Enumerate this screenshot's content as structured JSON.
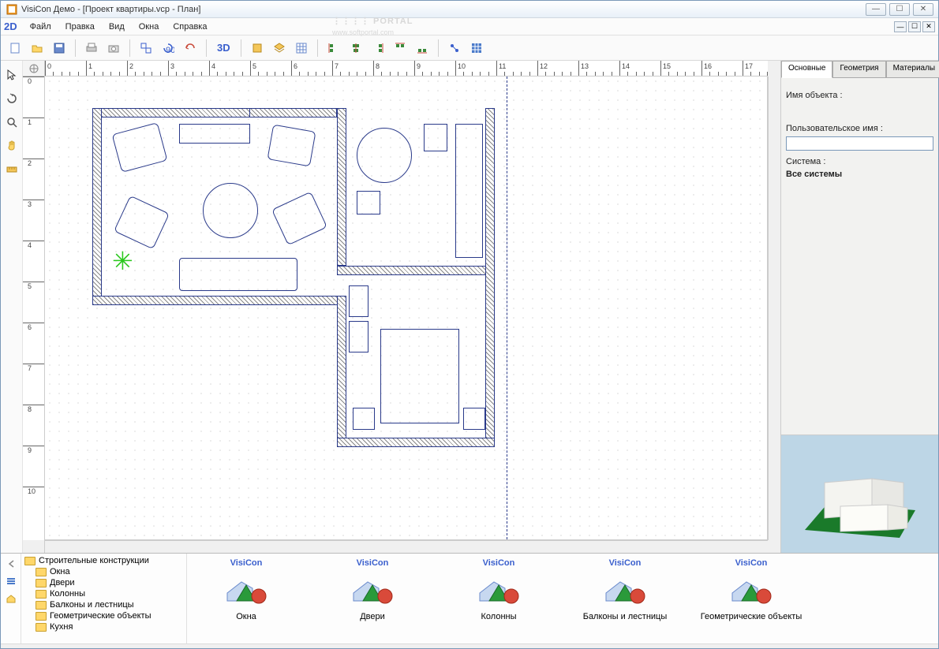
{
  "window": {
    "title": "VisiCon Демо - [Проект квартиры.vcp - План]"
  },
  "menu": {
    "mode": "2D",
    "items": [
      "Файл",
      "Правка",
      "Вид",
      "Окна",
      "Справка"
    ]
  },
  "toolbar": {
    "buttons": [
      "new",
      "open",
      "save",
      "print",
      "camera",
      "group",
      "rotate90",
      "undo",
      "mode3d",
      "layer1",
      "layer2",
      "grid",
      "align1",
      "align2",
      "align3",
      "align4",
      "align5",
      "snap",
      "hatch"
    ],
    "mode3d_label": "3D"
  },
  "left_tools": [
    "select",
    "rotate",
    "zoom",
    "pan",
    "measure"
  ],
  "ruler": {
    "h_start": 0,
    "h_end": 17,
    "v_start": 0,
    "v_end": 10
  },
  "right_panel": {
    "tabs": [
      "Основные",
      "Геометрия",
      "Материалы"
    ],
    "active_tab": 0,
    "object_name_label": "Имя объекта :",
    "object_name_value": "",
    "user_name_label": "Пользовательское имя :",
    "user_name_value": "",
    "system_label": "Система :",
    "system_value": "Все системы"
  },
  "catalog": {
    "tree_root": "Строительные конструкции",
    "tree_items": [
      "Окна",
      "Двери",
      "Колонны",
      "Балконы и лестницы",
      "Геометрические объекты",
      "Кухня"
    ],
    "brand": "VisiCon",
    "items": [
      "Окна",
      "Двери",
      "Колонны",
      "Балконы и лестницы",
      "Геометрические объекты"
    ]
  },
  "watermark": {
    "line1": "⋮⋮⋮⋮ PORTAL",
    "line2": "www.softportal.com"
  },
  "colors": {
    "accent": "#3a5fcd",
    "wall": "#2a3a8a",
    "plant": "#2bc81e",
    "preview_bg": "#bdd6e6",
    "ground": "#1a7a2a"
  }
}
